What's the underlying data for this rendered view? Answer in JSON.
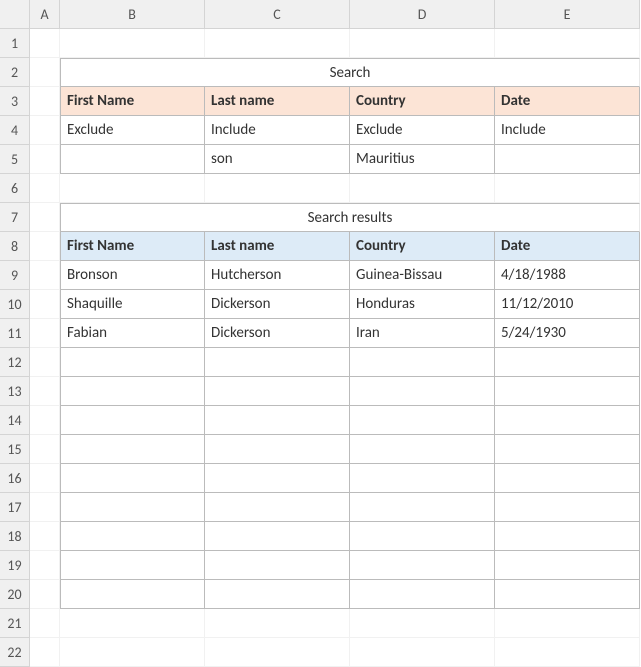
{
  "columns": [
    "A",
    "B",
    "C",
    "D",
    "E"
  ],
  "rows_total": 22,
  "search": {
    "title": "Search",
    "headers": [
      "First Name",
      "Last  name",
      "Country",
      "Date"
    ],
    "modes": [
      "Exclude",
      "Include",
      "Exclude",
      "Include"
    ],
    "terms": [
      "",
      "son",
      "Mauritius",
      ""
    ]
  },
  "results": {
    "title": "Search results",
    "headers": [
      "First Name",
      "Last  name",
      "Country",
      "Date"
    ],
    "rows": [
      [
        "Bronson",
        "Hutcherson",
        "Guinea-Bissau",
        "4/18/1988"
      ],
      [
        "Shaquille",
        "Dickerson",
        "Honduras",
        "11/12/2010"
      ],
      [
        "Fabian",
        "Dickerson",
        "Iran",
        "5/24/1930"
      ],
      [
        "",
        "",
        "",
        ""
      ],
      [
        "",
        "",
        "",
        ""
      ],
      [
        "",
        "",
        "",
        ""
      ],
      [
        "",
        "",
        "",
        ""
      ],
      [
        "",
        "",
        "",
        ""
      ],
      [
        "",
        "",
        "",
        ""
      ],
      [
        "",
        "",
        "",
        ""
      ],
      [
        "",
        "",
        "",
        ""
      ],
      [
        "",
        "",
        "",
        ""
      ]
    ]
  },
  "chart_data": {
    "type": "table",
    "title": "Search results",
    "columns": [
      "First Name",
      "Last name",
      "Country",
      "Date"
    ],
    "rows": [
      [
        "Bronson",
        "Hutcherson",
        "Guinea-Bissau",
        "4/18/1988"
      ],
      [
        "Shaquille",
        "Dickerson",
        "Honduras",
        "11/12/2010"
      ],
      [
        "Fabian",
        "Dickerson",
        "Iran",
        "5/24/1930"
      ]
    ]
  }
}
